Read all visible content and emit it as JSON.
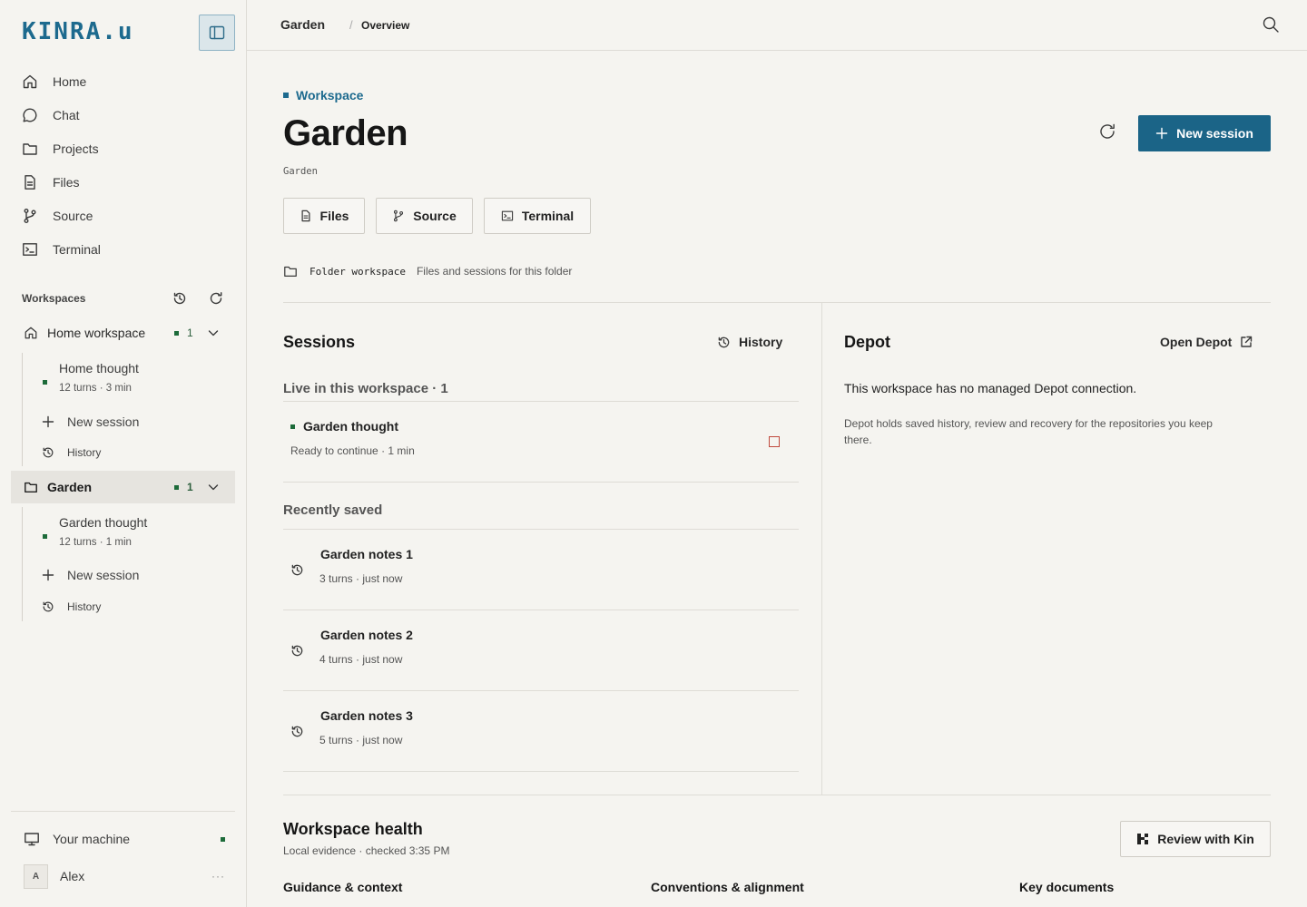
{
  "sidebar": {
    "logo": "KINRA.u",
    "nav": [
      {
        "label": "Home",
        "icon": "home-icon"
      },
      {
        "label": "Chat",
        "icon": "chat-icon"
      },
      {
        "label": "Projects",
        "icon": "folder-icon"
      },
      {
        "label": "Files",
        "icon": "file-icon"
      },
      {
        "label": "Source",
        "icon": "git-branch-icon"
      },
      {
        "label": "Terminal",
        "icon": "terminal-icon"
      }
    ],
    "workspaces_heading": "Workspaces",
    "workspaces": [
      {
        "name": "Home workspace",
        "count": "1",
        "icon": "home-icon",
        "session": {
          "title": "Home thought",
          "meta": "12 turns · 3 min"
        },
        "new_session": "New session",
        "history": "History"
      },
      {
        "name": "Garden",
        "count": "1",
        "icon": "folder-icon",
        "active": true,
        "session": {
          "title": "Garden thought",
          "meta": "12 turns · 1 min"
        },
        "new_session": "New session",
        "history": "History"
      }
    ],
    "machine": "Your machine",
    "user": {
      "initial": "A",
      "name": "Alex",
      "more": "···"
    }
  },
  "topbar": {
    "crumb_root": "Garden",
    "crumb_sep": "/",
    "crumb_current": "Overview"
  },
  "header": {
    "eyebrow": "Workspace",
    "title": "Garden",
    "subtitle": "Garden",
    "new_session": "New session"
  },
  "tools": [
    {
      "label": "Files",
      "icon": "file-icon"
    },
    {
      "label": "Source",
      "icon": "git-branch-icon"
    },
    {
      "label": "Terminal",
      "icon": "terminal-icon"
    }
  ],
  "folder": {
    "label": "Folder workspace",
    "desc": "Files and sessions for this folder"
  },
  "sessions": {
    "title": "Sessions",
    "history": "History",
    "live_heading": "Live in this workspace · 1",
    "live": {
      "title": "Garden thought",
      "meta": "Ready to continue · 1 min"
    },
    "saved_heading": "Recently saved",
    "saved": [
      {
        "title": "Garden notes 1",
        "meta": "3 turns · just now"
      },
      {
        "title": "Garden notes 2",
        "meta": "4 turns · just now"
      },
      {
        "title": "Garden notes 3",
        "meta": "5 turns · just now"
      }
    ]
  },
  "depot": {
    "title": "Depot",
    "open": "Open Depot",
    "message": "This workspace has no managed Depot connection.",
    "desc": "Depot holds saved history, review and recovery for the repositories you keep there."
  },
  "health": {
    "title": "Workspace health",
    "sub": "Local evidence · checked 3:35 PM",
    "review": "Review with Kin",
    "columns": [
      "Guidance & context",
      "Conventions & alignment",
      "Key documents"
    ]
  },
  "colors": {
    "accent": "#1b6487",
    "live": "#1d6b3a",
    "stop": "#c04a3e",
    "background": "#f5f4f0"
  }
}
